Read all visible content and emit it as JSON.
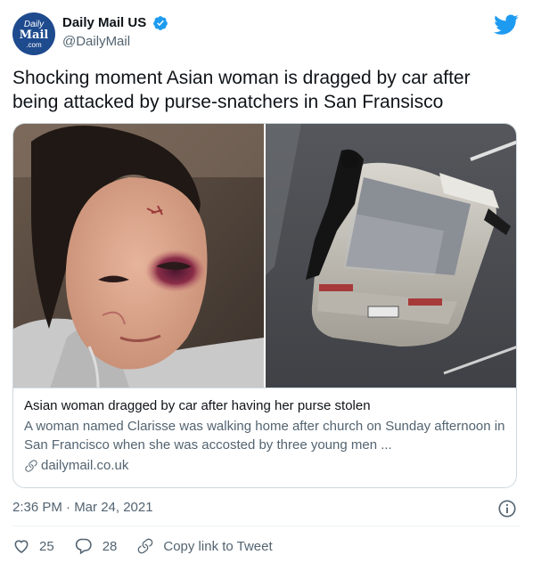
{
  "author": {
    "avatar_line1": "Daily",
    "avatar_line2": "Mail",
    "avatar_line3": ".com",
    "display_name": "Daily Mail US",
    "handle": "@DailyMail",
    "verified": true
  },
  "tweet": {
    "text": "Shocking moment Asian woman is dragged by car after being attacked by purse-snatchers in San Fransisco",
    "timestamp": "2:36 PM · Mar 24, 2021"
  },
  "card": {
    "title": "Asian woman dragged by car after having her purse stolen",
    "description": "A woman named Clarisse was walking home after church on Sunday afternoon in San Francisco when she was accosted by three young men ...",
    "domain": "dailymail.co.uk"
  },
  "actions": {
    "likes": "25",
    "replies": "28",
    "copy_link_label": "Copy link to Tweet"
  },
  "icons": {
    "brand": "twitter-bird-icon",
    "verified": "verified-badge-icon",
    "info": "info-icon",
    "like": "heart-icon",
    "reply": "reply-bubble-icon",
    "link": "link-icon"
  },
  "colors": {
    "twitter_blue": "#1d9bf0",
    "avatar_bg": "#1e4a8e",
    "secondary_text": "#536471",
    "border": "#cfd9de"
  }
}
